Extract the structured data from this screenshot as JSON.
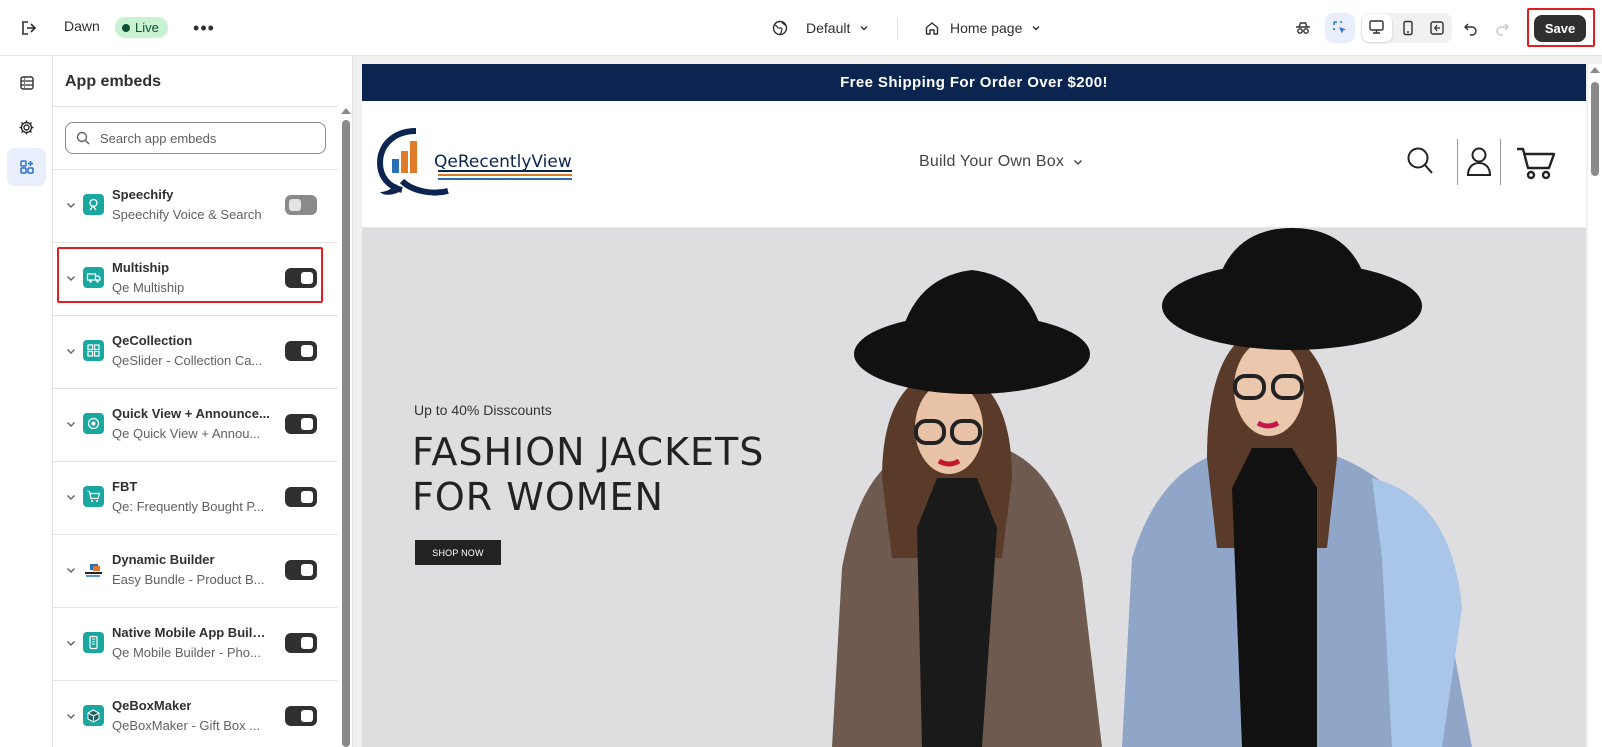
{
  "topbar": {
    "theme_name": "Dawn",
    "status_badge": "Live",
    "more_label": "•••",
    "preset_label": "Default",
    "page_label": "Home page",
    "save_label": "Save"
  },
  "panel": {
    "title": "App embeds",
    "search_placeholder": "Search app embeds"
  },
  "embeds": [
    {
      "name": "Speechify",
      "subtitle": "Speechify Voice & Search",
      "enabled": false,
      "icon": "speechify-icon"
    },
    {
      "name": "Multiship",
      "subtitle": "Qe Multiship",
      "enabled": true,
      "icon": "truck-icon"
    },
    {
      "name": "QeCollection",
      "subtitle": "QeSlider - Collection Ca...",
      "enabled": true,
      "icon": "collection-icon"
    },
    {
      "name": "Quick View + Announce...",
      "subtitle": "Qe Quick View + Annou...",
      "enabled": true,
      "icon": "quick-view-icon"
    },
    {
      "name": "FBT",
      "subtitle": "Qe: Frequently Bought P...",
      "enabled": true,
      "icon": "cart-icon"
    },
    {
      "name": "Dynamic Builder",
      "subtitle": "Easy Bundle - Product B...",
      "enabled": true,
      "icon": "bundle-icon"
    },
    {
      "name": "Native Mobile App Builder",
      "subtitle": "Qe Mobile Builder - Pho...",
      "enabled": true,
      "icon": "mobile-icon"
    },
    {
      "name": "QeBoxMaker",
      "subtitle": "QeBoxMaker - Gift Box ...",
      "enabled": true,
      "icon": "gift-box-icon"
    }
  ],
  "store": {
    "announcement": "Free Shipping For Order Over $200!",
    "logo_text": "QeRecentlyView",
    "nav_item": "Build Your Own Box",
    "hero_kicker": "Up to 40% Disscounts",
    "hero_title_line1": "FASHION JACKETS",
    "hero_title_line2": "FOR WOMEN",
    "hero_button": "SHOP NOW"
  },
  "colors": {
    "accent": "#303030",
    "live_badge_bg": "#c9f2d3",
    "announcement_bg": "#0b2550",
    "highlight": "#e02020",
    "teal_icon": "#1aa7a0"
  }
}
